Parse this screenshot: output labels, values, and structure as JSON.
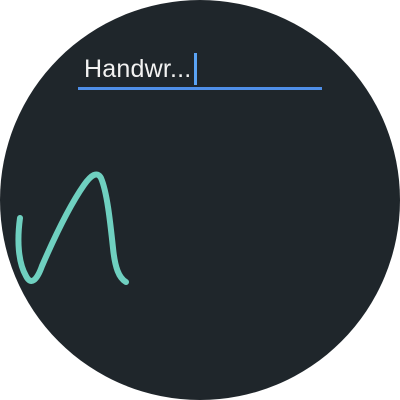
{
  "input": {
    "value": "Handwr..."
  },
  "colors": {
    "background": "#1f262b",
    "underline": "#4f8fe8",
    "cursor": "#5aa3f5",
    "ink": "#6fd0c0",
    "text": "#f2f2f2"
  },
  "icons": {
    "cursor": "text-cursor"
  }
}
